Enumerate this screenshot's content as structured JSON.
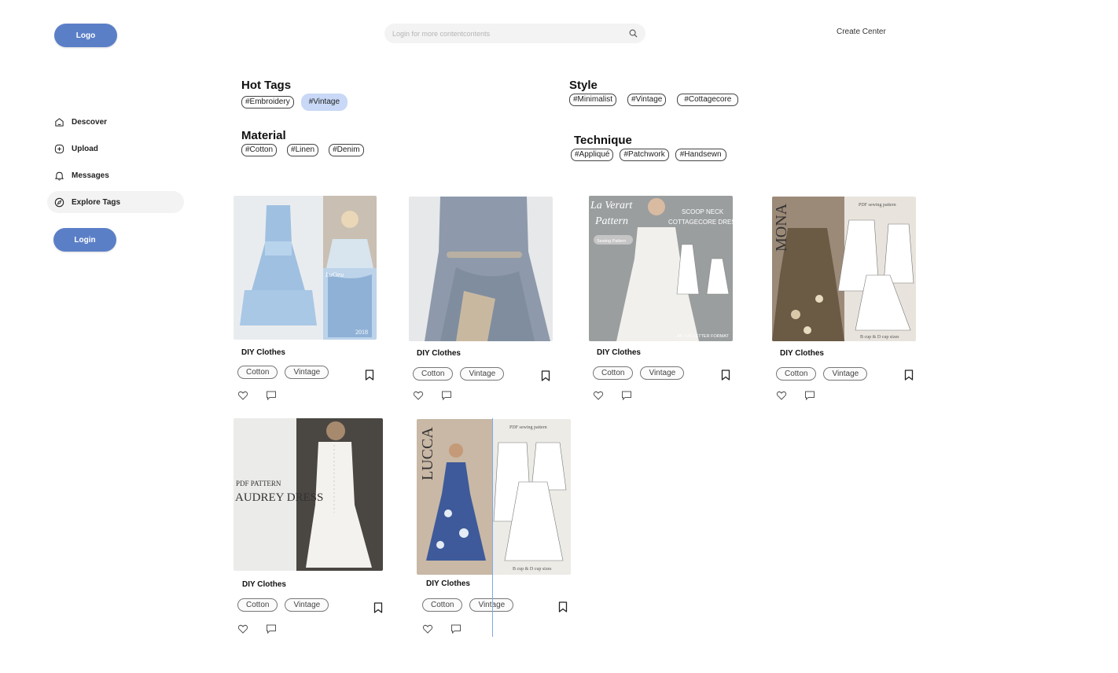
{
  "header": {
    "logo_label": "Logo",
    "search_placeholder": "Login for more contentcontents",
    "search_icon": "search-icon",
    "create_center": "Create Center"
  },
  "sidebar": {
    "items": [
      {
        "label": "Descover",
        "icon": "home-icon",
        "active": false
      },
      {
        "label": "Upload",
        "icon": "plus-circle-icon",
        "active": false
      },
      {
        "label": "Messages",
        "icon": "bell-icon",
        "active": false
      },
      {
        "label": "Explore Tags",
        "icon": "compass-icon",
        "active": true
      }
    ],
    "login_label": "Login"
  },
  "tag_groups": {
    "hot": {
      "title": "Hot Tags",
      "tags": [
        "#Embroidery",
        "#Vintage"
      ],
      "active": "#Vintage"
    },
    "style": {
      "title": "Style",
      "tags": [
        "#Minimalist",
        "#Vintage",
        "#Cottagecore"
      ]
    },
    "material": {
      "title": "Material",
      "tags": [
        "#Cotton",
        "#Linen",
        "#Denim"
      ]
    },
    "technique": {
      "title": "Technique",
      "tags": [
        "#Appliqué",
        "#Patchwork",
        "#Handsewn"
      ]
    }
  },
  "cards": [
    {
      "title": "DIY Clothes",
      "chips": [
        "Cotton",
        "Vintage"
      ],
      "image_text": [
        "LuCtru",
        "2018"
      ]
    },
    {
      "title": "DIY Clothes",
      "chips": [
        "Cotton",
        "Vintage"
      ],
      "image_text": []
    },
    {
      "title": "DIY Clothes",
      "chips": [
        "Cotton",
        "Vintage"
      ],
      "image_text": [
        "La Verart",
        "Pattern",
        "Sewing Pattern",
        "SCOOP NECK",
        "COTTAGECORE DRESS",
        "A4 / US LETTER FORMAT"
      ]
    },
    {
      "title": "DIY Clothes",
      "chips": [
        "Cotton",
        "Vintage"
      ],
      "image_text": [
        "MONA",
        "PDF sewing pattern",
        "B cup & D cup sizes"
      ]
    },
    {
      "title": "DIY Clothes",
      "chips": [
        "Cotton",
        "Vintage"
      ],
      "image_text": [
        "PDF PATTERN",
        "AUDREY DRESS"
      ]
    },
    {
      "title": "DIY Clothes",
      "chips": [
        "Cotton",
        "Vintage"
      ],
      "image_text": [
        "LUCCA",
        "PDF sewing pattern",
        "B cup & D cup sizes"
      ]
    }
  ],
  "colors": {
    "accent": "#5b7fc7",
    "active_tag": "#c8d8f6",
    "nav_active": "#f3f3f3"
  }
}
